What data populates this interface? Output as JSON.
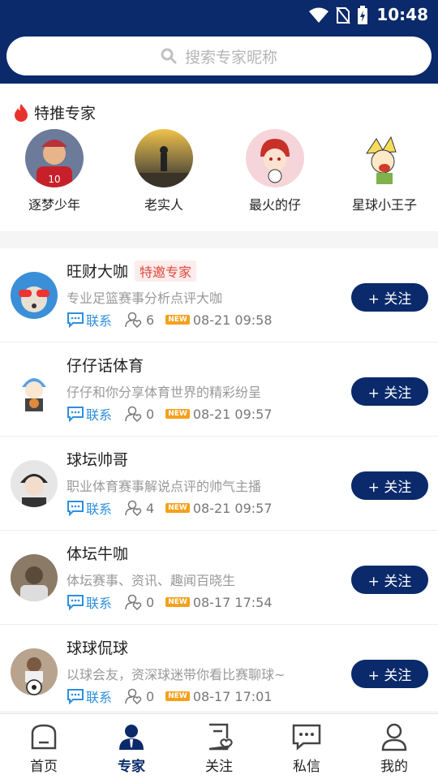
{
  "status": {
    "time": "10:48"
  },
  "search": {
    "placeholder": "搜索专家昵称"
  },
  "featured": {
    "title": "特推专家",
    "experts": [
      {
        "name": "逐梦少年"
      },
      {
        "name": "老实人"
      },
      {
        "name": "最火的仔"
      },
      {
        "name": "星球小王子"
      }
    ]
  },
  "list": {
    "contact_label": "联系",
    "follow_label": "+ 关注",
    "new_badge": "NEW",
    "items": [
      {
        "name": "旺财大咖",
        "tag": "特邀专家",
        "desc": "专业足篮赛事分析点评大咖",
        "fans": "6",
        "time": "08-21 09:58"
      },
      {
        "name": "仔仔话体育",
        "tag": "",
        "desc": "仔仔和你分享体育世界的精彩纷呈",
        "fans": "0",
        "time": "08-21 09:57"
      },
      {
        "name": "球坛帅哥",
        "tag": "",
        "desc": "职业体育赛事解说点评的帅气主播",
        "fans": "4",
        "time": "08-21 09:57"
      },
      {
        "name": "体坛牛咖",
        "tag": "",
        "desc": "体坛赛事、资讯、趣闻百晓生",
        "fans": "0",
        "time": "08-17 17:54"
      },
      {
        "name": "球球侃球",
        "tag": "",
        "desc": "以球会友，资深球迷带你看比赛聊球~",
        "fans": "0",
        "time": "08-17 17:01"
      }
    ]
  },
  "tabs": [
    {
      "label": "首页"
    },
    {
      "label": "专家"
    },
    {
      "label": "关注"
    },
    {
      "label": "私信"
    },
    {
      "label": "我的"
    }
  ],
  "colors": {
    "primary": "#0a2a6b",
    "accent_blue": "#2d8fe0",
    "tag_red": "#e0493e",
    "new_orange": "#f4a11c"
  }
}
